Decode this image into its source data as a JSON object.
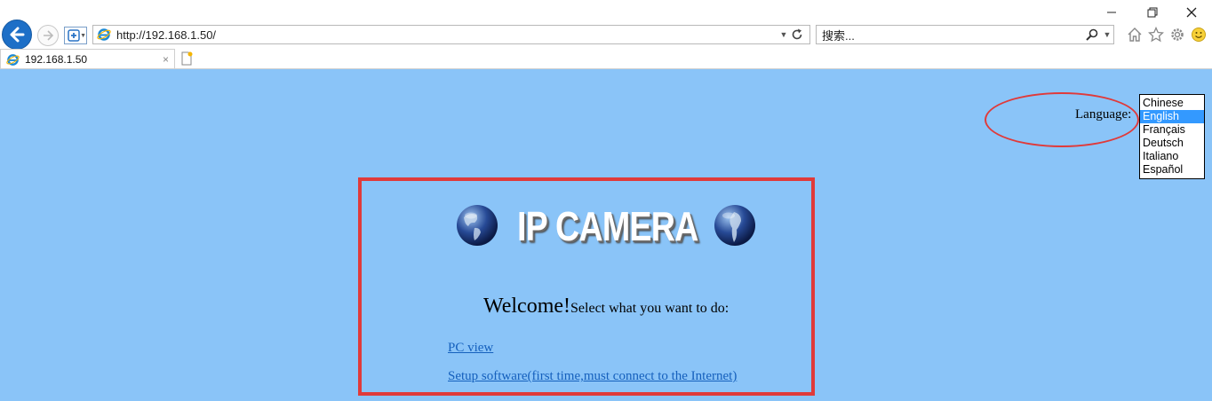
{
  "browser": {
    "url": "http://192.168.1.50/",
    "search_placeholder": "搜索...",
    "tab_title": "192.168.1.50",
    "tab_close": "×"
  },
  "page": {
    "language_label": "Language:",
    "languages": [
      "Chinese",
      "English",
      "Français",
      "Deutsch",
      "Italiano",
      "Español"
    ],
    "selected_language": "English",
    "logo_text": "IP CAMERA",
    "welcome_big": "Welcome!",
    "welcome_small": "Select what you want to do:",
    "links": [
      "PC view",
      "Setup software(first time,must connect to the Internet)"
    ]
  },
  "colors": {
    "page_background": "#8ac4f8",
    "highlight_red": "#e03a3a",
    "link_blue": "#1560bd",
    "selection_blue": "#3399ff"
  },
  "icons": [
    "back-arrow-icon",
    "forward-arrow-icon",
    "security-shield-icon",
    "ie-logo-icon",
    "refresh-icon",
    "search-icon",
    "home-icon",
    "favorites-star-icon",
    "settings-gear-icon",
    "smiley-feedback-icon",
    "minimize-icon",
    "restore-icon",
    "close-icon",
    "new-tab-icon",
    "globe-icon"
  ]
}
